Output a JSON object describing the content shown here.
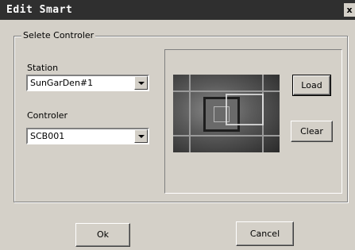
{
  "window": {
    "title": "Edit Smart",
    "close_glyph": "x"
  },
  "group": {
    "legend": "Selete Controler"
  },
  "station": {
    "label": "Station",
    "value": "SunGarDen#1"
  },
  "controller": {
    "label": "Controler",
    "value": "SCB001"
  },
  "preview": {
    "image_icon": "circuit-board-image"
  },
  "buttons": {
    "load": "Load",
    "clear": "Clear",
    "ok": "Ok",
    "cancel": "Cancel"
  }
}
